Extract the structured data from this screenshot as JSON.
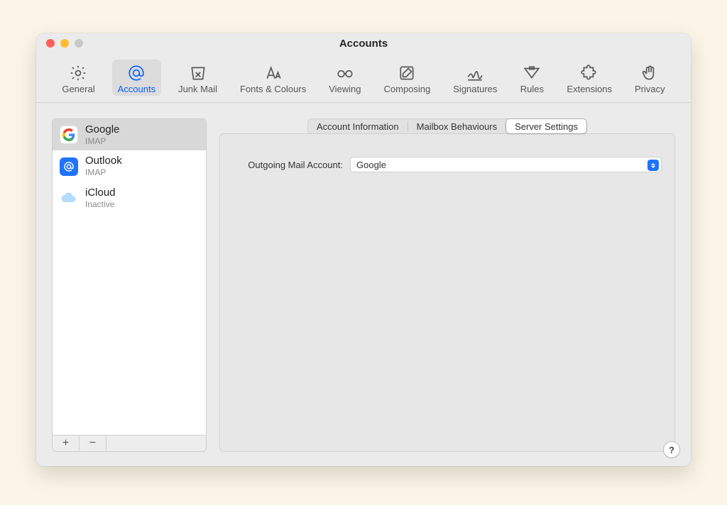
{
  "window": {
    "title": "Accounts"
  },
  "toolbar": {
    "items": [
      {
        "id": "general",
        "label": "General"
      },
      {
        "id": "accounts",
        "label": "Accounts"
      },
      {
        "id": "junk",
        "label": "Junk Mail"
      },
      {
        "id": "fonts",
        "label": "Fonts & Colours"
      },
      {
        "id": "viewing",
        "label": "Viewing"
      },
      {
        "id": "composing",
        "label": "Composing"
      },
      {
        "id": "signatures",
        "label": "Signatures"
      },
      {
        "id": "rules",
        "label": "Rules"
      },
      {
        "id": "extensions",
        "label": "Extensions"
      },
      {
        "id": "privacy",
        "label": "Privacy"
      }
    ],
    "active": "accounts"
  },
  "accounts": {
    "items": [
      {
        "name": "Google",
        "subtitle": "IMAP",
        "icon": "google",
        "selected": true
      },
      {
        "name": "Outlook",
        "subtitle": "IMAP",
        "icon": "outlook",
        "selected": false
      },
      {
        "name": "iCloud",
        "subtitle": "Inactive",
        "icon": "icloud",
        "selected": false
      }
    ],
    "add_label": "+",
    "remove_label": "−"
  },
  "tabs": {
    "items": [
      {
        "label": "Account Information"
      },
      {
        "label": "Mailbox Behaviours"
      },
      {
        "label": "Server Settings"
      }
    ],
    "active_index": 2
  },
  "form": {
    "outgoing_label": "Outgoing Mail Account:",
    "outgoing_value": "Google"
  },
  "help_label": "?"
}
